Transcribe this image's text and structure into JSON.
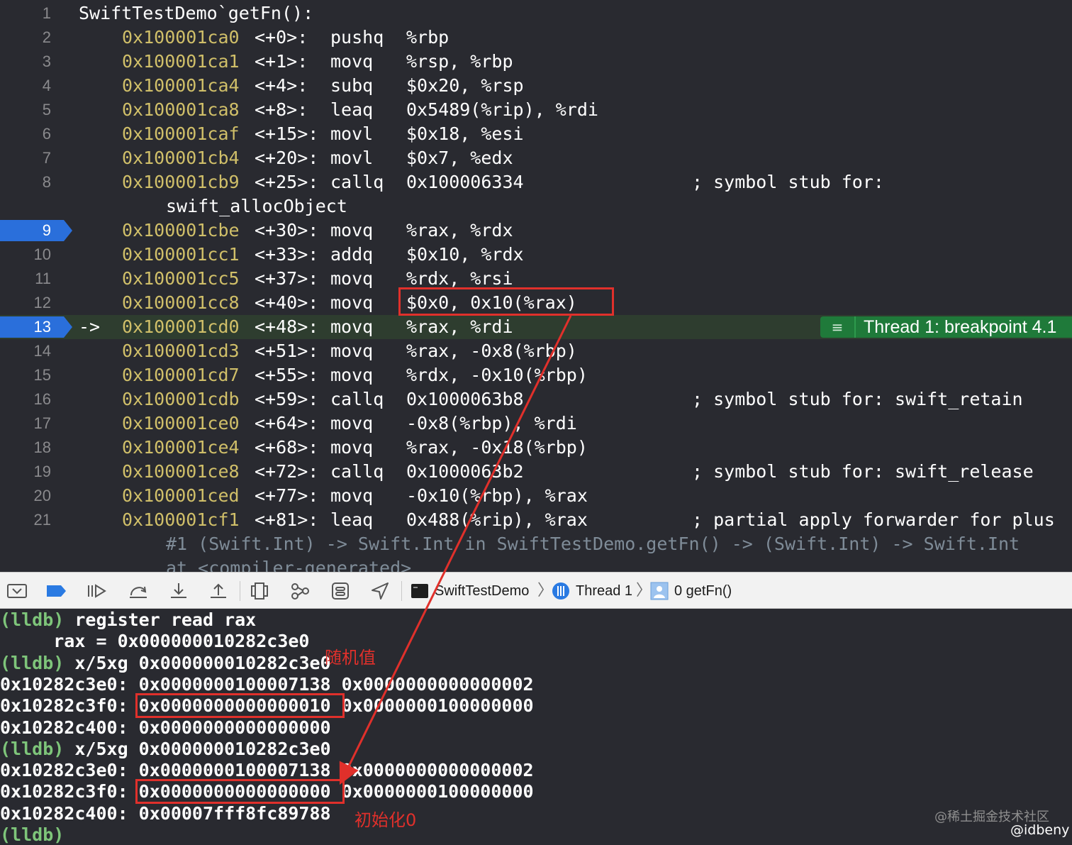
{
  "disassembly": {
    "header": {
      "line": "1",
      "text": "SwiftTestDemo`getFn():"
    },
    "rows": [
      {
        "line": "2",
        "addr": "0x100001ca0",
        "offset": "<+0>:",
        "mnemonic": "pushq",
        "operands": "%rbp",
        "comment": ""
      },
      {
        "line": "3",
        "addr": "0x100001ca1",
        "offset": "<+1>:",
        "mnemonic": "movq",
        "operands": "%rsp, %rbp",
        "comment": ""
      },
      {
        "line": "4",
        "addr": "0x100001ca4",
        "offset": "<+4>:",
        "mnemonic": "subq",
        "operands": "$0x20, %rsp",
        "comment": ""
      },
      {
        "line": "5",
        "addr": "0x100001ca8",
        "offset": "<+8>:",
        "mnemonic": "leaq",
        "operands": "0x5489(%rip), %rdi",
        "comment": ""
      },
      {
        "line": "6",
        "addr": "0x100001caf",
        "offset": "<+15>:",
        "mnemonic": "movl",
        "operands": "$0x18, %esi",
        "comment": ""
      },
      {
        "line": "7",
        "addr": "0x100001cb4",
        "offset": "<+20>:",
        "mnemonic": "movl",
        "operands": "$0x7, %edx",
        "comment": ""
      },
      {
        "line": "8",
        "addr": "0x100001cb9",
        "offset": "<+25>:",
        "mnemonic": "callq",
        "operands": "0x100006334",
        "comment": "; symbol stub for:"
      },
      {
        "line": "",
        "continuation": "swift_allocObject"
      },
      {
        "line": "9",
        "addr": "0x100001cbe",
        "offset": "<+30>:",
        "mnemonic": "movq",
        "operands": "%rax, %rdx",
        "comment": "",
        "breakpoint": true
      },
      {
        "line": "10",
        "addr": "0x100001cc1",
        "offset": "<+33>:",
        "mnemonic": "addq",
        "operands": "$0x10, %rdx",
        "comment": ""
      },
      {
        "line": "11",
        "addr": "0x100001cc5",
        "offset": "<+37>:",
        "mnemonic": "movq",
        "operands": "%rdx, %rsi",
        "comment": ""
      },
      {
        "line": "12",
        "addr": "0x100001cc8",
        "offset": "<+40>:",
        "mnemonic": "movq",
        "operands": "$0x0, 0x10(%rax)",
        "comment": "",
        "highlight": true
      },
      {
        "line": "13",
        "addr": "0x100001cd0",
        "offset": "<+48>:",
        "mnemonic": "movq",
        "operands": "%rax, %rdi",
        "comment": "",
        "breakpoint": true,
        "current": true,
        "arrow": "->"
      },
      {
        "line": "14",
        "addr": "0x100001cd3",
        "offset": "<+51>:",
        "mnemonic": "movq",
        "operands": "%rax, -0x8(%rbp)",
        "comment": ""
      },
      {
        "line": "15",
        "addr": "0x100001cd7",
        "offset": "<+55>:",
        "mnemonic": "movq",
        "operands": "%rdx, -0x10(%rbp)",
        "comment": ""
      },
      {
        "line": "16",
        "addr": "0x100001cdb",
        "offset": "<+59>:",
        "mnemonic": "callq",
        "operands": "0x1000063b8",
        "comment": "; symbol stub for: swift_retain"
      },
      {
        "line": "17",
        "addr": "0x100001ce0",
        "offset": "<+64>:",
        "mnemonic": "movq",
        "operands": "-0x8(%rbp), %rdi",
        "comment": ""
      },
      {
        "line": "18",
        "addr": "0x100001ce4",
        "offset": "<+68>:",
        "mnemonic": "movq",
        "operands": "%rax, -0x18(%rbp)",
        "comment": ""
      },
      {
        "line": "19",
        "addr": "0x100001ce8",
        "offset": "<+72>:",
        "mnemonic": "callq",
        "operands": "0x1000063b2",
        "comment": "; symbol stub for: swift_release"
      },
      {
        "line": "20",
        "addr": "0x100001ced",
        "offset": "<+77>:",
        "mnemonic": "movq",
        "operands": "-0x10(%rbp), %rax",
        "comment": ""
      },
      {
        "line": "21",
        "addr": "0x100001cf1",
        "offset": "<+81>:",
        "mnemonic": "leaq",
        "operands": "0x488(%rip), %rax",
        "comment": "; partial apply forwarder for plus"
      },
      {
        "line": "",
        "continuation": "#1 (Swift.Int) -> Swift.Int in SwiftTestDemo.getFn() -> (Swift.Int) -> Swift.Int",
        "dim": true
      },
      {
        "line": "",
        "continuation": "at <compiler-generated>",
        "dim": true
      }
    ],
    "thread_banner": "Thread 1: breakpoint 4.1"
  },
  "debug_bar": {
    "icons": [
      "hide-console-icon",
      "breakpoints-toggle-icon",
      "continue-icon",
      "step-over-icon",
      "step-into-icon",
      "step-out-icon",
      "view-hierarchy-icon",
      "memory-graph-icon",
      "environment-overrides-icon",
      "simulate-location-icon"
    ],
    "breadcrumb": {
      "target": "SwiftTestDemo",
      "thread": "Thread 1",
      "frame": "0 getFn()"
    }
  },
  "console": {
    "lines": [
      {
        "prompt": "(lldb)",
        "text": " register read rax"
      },
      {
        "prompt": "",
        "text": "     rax = 0x000000010282c3e0"
      },
      {
        "prompt": "(lldb)",
        "text": " x/5xg 0x000000010282c3e0"
      },
      {
        "prompt": "",
        "text": "0x10282c3e0: 0x0000000100007138 0x0000000000000002"
      },
      {
        "prompt": "",
        "text": "0x10282c3f0: 0x0000000000000010 0x0000000100000000"
      },
      {
        "prompt": "",
        "text": "0x10282c400: 0x0000000000000000"
      },
      {
        "prompt": "(lldb)",
        "text": " x/5xg 0x000000010282c3e0"
      },
      {
        "prompt": "",
        "text": "0x10282c3e0: 0x0000000100007138 0x0000000000000002"
      },
      {
        "prompt": "",
        "text": "0x10282c3f0: 0x0000000000000000 0x0000000100000000"
      },
      {
        "prompt": "",
        "text": "0x10282c400: 0x00007fff8fc89788"
      },
      {
        "prompt": "(lldb)",
        "text": ""
      }
    ]
  },
  "annotations": {
    "random_value": "随机值",
    "initialized_zero": "初始化0"
  },
  "watermark": {
    "site": "@稀土掘金技术社区",
    "author": "@idbeny"
  },
  "colors": {
    "address": "#d0bf69",
    "prompt": "#7ec57a",
    "annotation": "#e0302b",
    "breakpoint": "#2a6fdb",
    "thread_banner": "#1f7a3a"
  }
}
